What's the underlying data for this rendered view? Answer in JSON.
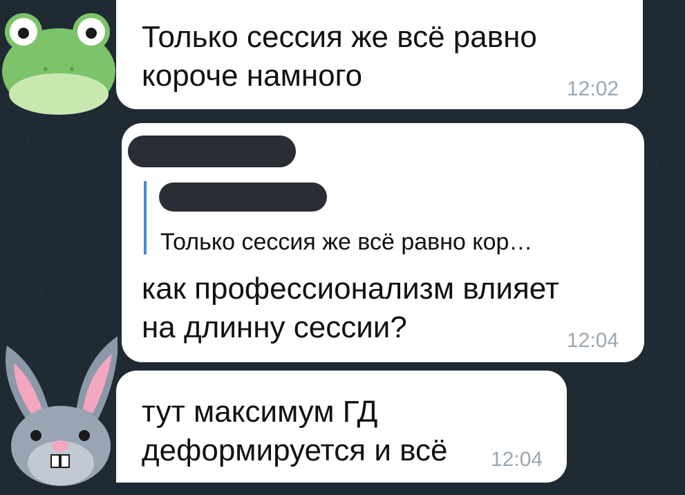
{
  "messages": [
    {
      "line1": "Только сессия же всё равно",
      "line2": "короче намного",
      "time": "12:02"
    },
    {
      "quote": "Только сессия же всё равно кор…",
      "line1": "как профессионализм влияет",
      "line2": "на длинну сессии?",
      "time": "12:04"
    },
    {
      "line1": "тут максимум ГД",
      "line2": "деформируется и всё",
      "time": "12:04"
    }
  ],
  "avatars": [
    "frog-avatar",
    "bunny-avatar"
  ],
  "colors": {
    "background": "#1f2a33",
    "bubble": "#ffffff",
    "reply_accent": "#3b8dd6",
    "timestamp": "#9aa7b2"
  }
}
